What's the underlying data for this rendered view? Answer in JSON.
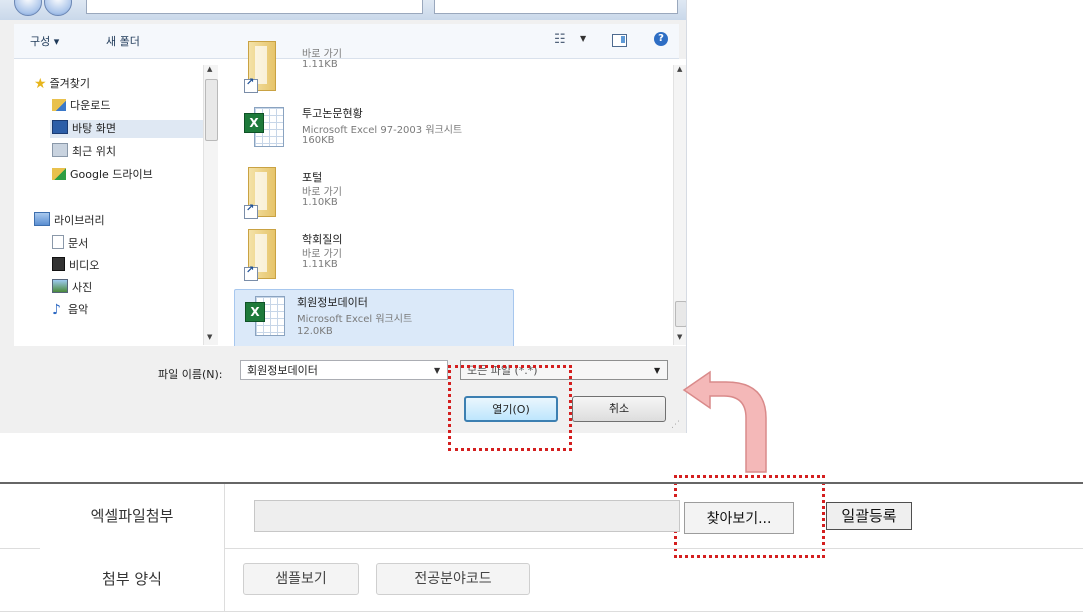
{
  "toolbar": {
    "organize": "구성 ▾",
    "new_folder": "새 폴더",
    "help": "?"
  },
  "nav": {
    "favorites": "즐겨찾기",
    "items": [
      {
        "label": "다운로드",
        "icon": "downloads-folder-icon"
      },
      {
        "label": "바탕 화면",
        "icon": "desktop-icon",
        "selected": true
      },
      {
        "label": "최근 위치",
        "icon": "recent-places-icon"
      },
      {
        "label": "Google 드라이브",
        "icon": "google-drive-folder-icon"
      }
    ],
    "libraries": "라이브러리",
    "library_items": [
      {
        "label": "문서",
        "icon": "documents-icon"
      },
      {
        "label": "비디오",
        "icon": "videos-icon"
      },
      {
        "label": "사진",
        "icon": "pictures-icon"
      },
      {
        "label": "음악",
        "icon": "music-icon"
      }
    ]
  },
  "files": [
    {
      "name": "",
      "type": "바로 가기",
      "size": "1.11KB",
      "kind": "shortcut"
    },
    {
      "name": "투고논문현황",
      "type": "Microsoft Excel 97-2003 워크시트",
      "size": "160KB",
      "kind": "excel"
    },
    {
      "name": "포털",
      "type": "바로 가기",
      "size": "1.10KB",
      "kind": "shortcut"
    },
    {
      "name": "학회질의",
      "type": "바로 가기",
      "size": "1.11KB",
      "kind": "shortcut"
    },
    {
      "name": "회원정보데이터",
      "type": "Microsoft Excel 워크시트",
      "size": "12.0KB",
      "kind": "excel",
      "selected": true
    }
  ],
  "dialog": {
    "filename_label": "파일 이름(N):",
    "filename_value": "회원정보데이터",
    "filetype_value": "모든 파일 (*.*)",
    "open_button": "열기(O)",
    "cancel_button": "취소"
  },
  "form": {
    "attach_label": "엑셀파일첨부",
    "browse_button": "찾아보기...",
    "bulk_register_button": "일괄등록",
    "template_label": "첨부 양식",
    "sample_button": "샘플보기",
    "code_button": "전공분야코드"
  },
  "colors": {
    "highlight": "#d41f1f",
    "arrow_fill": "#f4b8b8"
  }
}
